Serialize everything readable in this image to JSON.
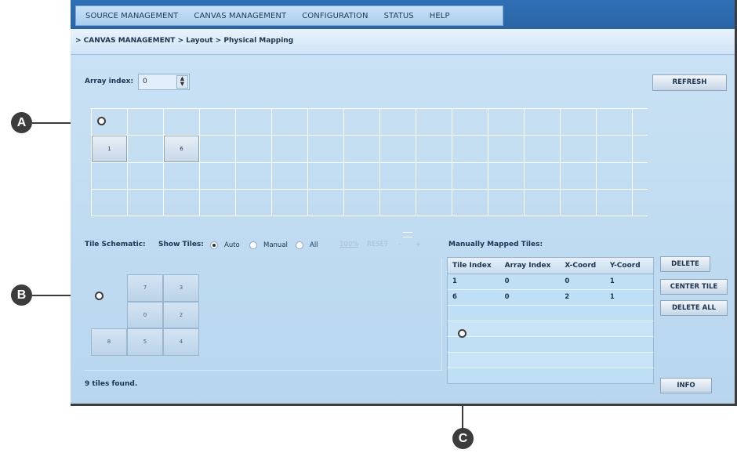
{
  "menu": [
    "SOURCE MANAGEMENT",
    "CANVAS MANAGEMENT",
    "CONFIGURATION",
    "STATUS",
    "HELP"
  ],
  "breadcrumb": "> CANVAS MANAGEMENT > Layout > Physical Mapping",
  "array_index": {
    "label": "Array index:",
    "value": "0"
  },
  "refresh_label": "REFRESH",
  "mapped_grid_tiles": [
    "1",
    "6"
  ],
  "schematic": {
    "label": "Tile Schematic:",
    "show_tiles_label": "Show Tiles:",
    "options": [
      "Auto",
      "Manual",
      "All"
    ],
    "selected": "Auto",
    "zoom": "100%",
    "reset": "RESET",
    "minus": "-",
    "plus": "+",
    "tiles": [
      "7",
      "3",
      "0",
      "2",
      "8",
      "5",
      "4"
    ]
  },
  "manual_table": {
    "title": "Manually Mapped Tiles:",
    "headers": [
      "Tile Index",
      "Array Index",
      "X-Coord",
      "Y-Coord"
    ],
    "rows": [
      [
        "1",
        "0",
        "0",
        "1"
      ],
      [
        "6",
        "0",
        "2",
        "1"
      ]
    ]
  },
  "buttons": {
    "delete": "DELETE",
    "center_tile": "CENTER TILE",
    "delete_all": "DELETE ALL",
    "info": "INFO"
  },
  "status": "9 tiles found.",
  "callouts": [
    "A",
    "B",
    "C"
  ]
}
